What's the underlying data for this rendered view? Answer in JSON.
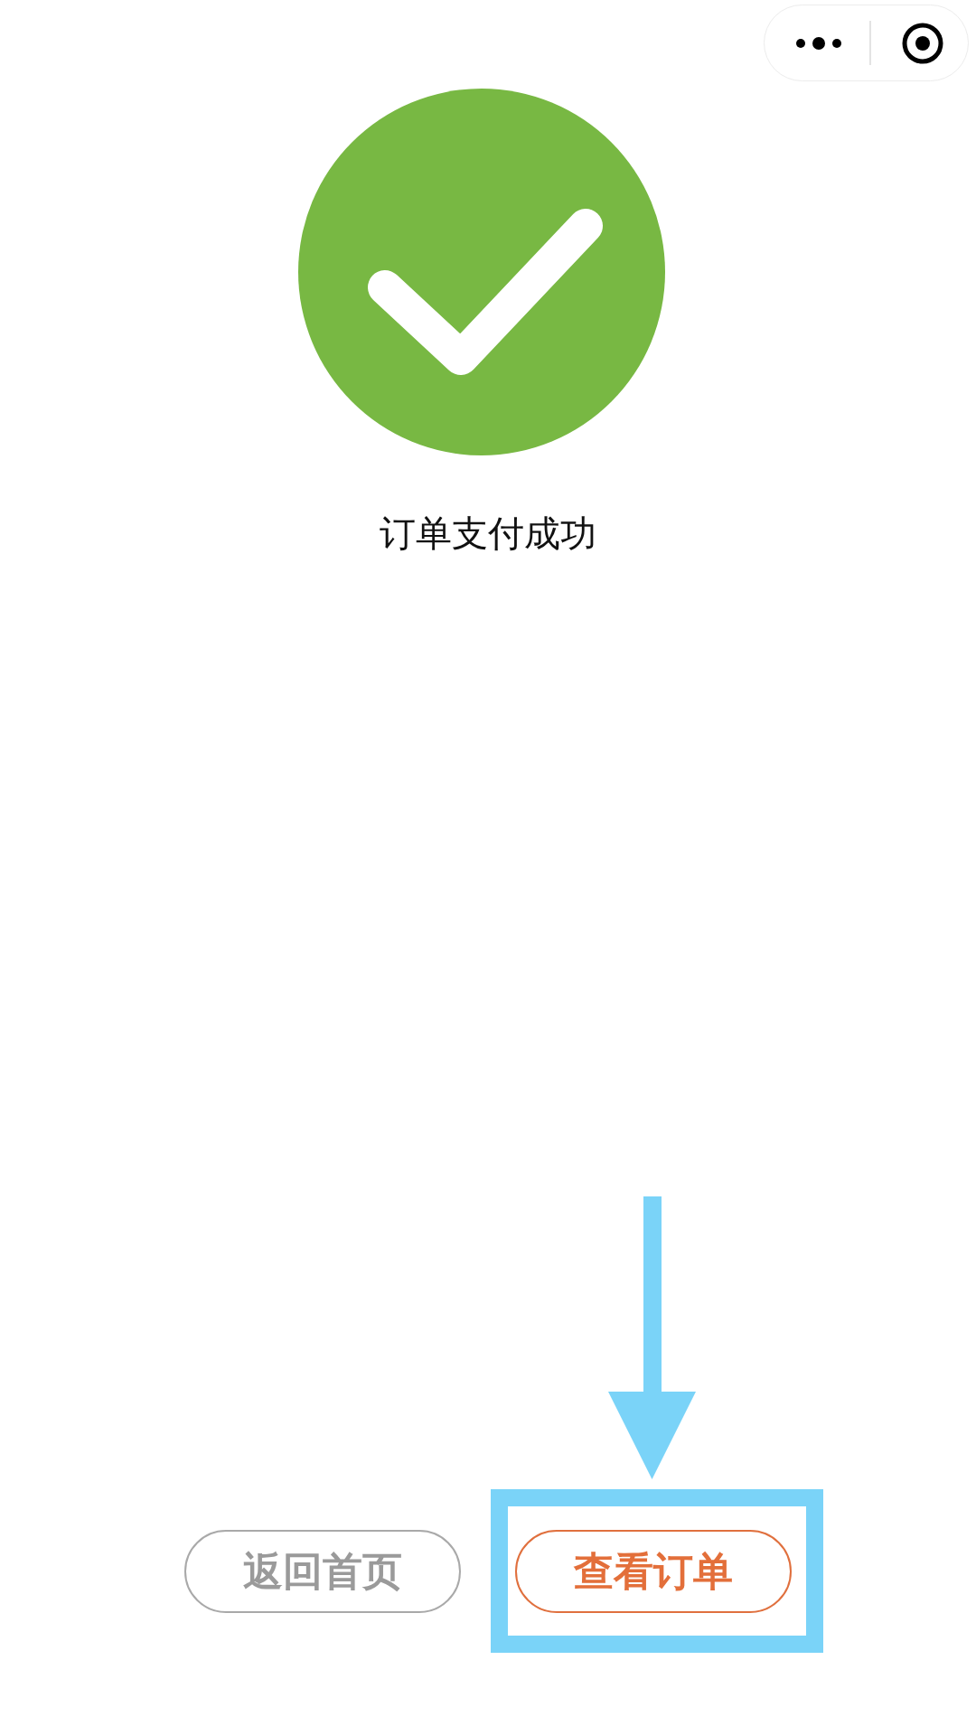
{
  "result": {
    "title": "订单支付成功"
  },
  "buttons": [
    {
      "label": "返回首页",
      "kind": "secondary",
      "highlighted": false
    },
    {
      "label": "查看订单",
      "kind": "primary",
      "highlighted": true
    }
  ]
}
